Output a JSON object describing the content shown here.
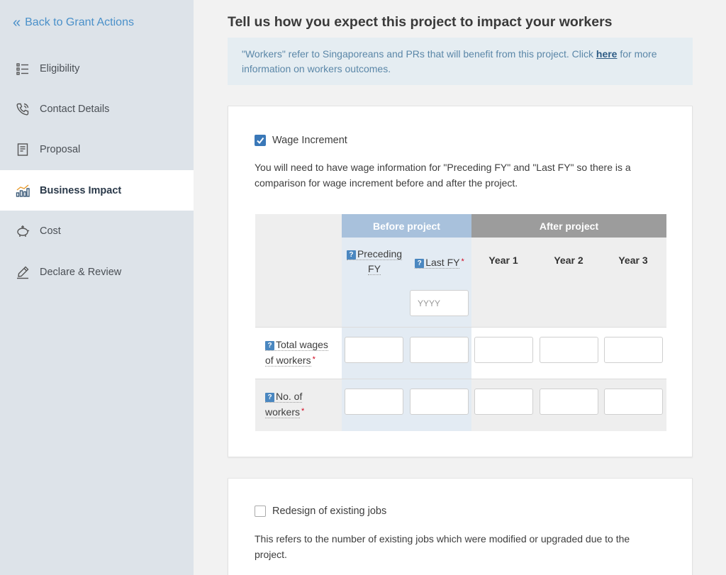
{
  "sidebar": {
    "back_label": "Back to Grant Actions",
    "items": [
      {
        "label": "Eligibility",
        "icon": "list-icon"
      },
      {
        "label": "Contact Details",
        "icon": "phone-icon"
      },
      {
        "label": "Proposal",
        "icon": "document-icon"
      },
      {
        "label": "Business Impact",
        "icon": "bar-chart-icon",
        "active": true
      },
      {
        "label": "Cost",
        "icon": "piggy-bank-icon"
      },
      {
        "label": "Declare & Review",
        "icon": "pen-icon"
      }
    ]
  },
  "main": {
    "title": "Tell us how you expect this project to impact your workers",
    "info": {
      "text_before": "\"Workers\" refer to Singaporeans and PRs that will benefit from this project. Click ",
      "link": "here",
      "text_after": " for more information on workers outcomes."
    },
    "wage_section": {
      "checkbox_label": "Wage Increment",
      "checked": true,
      "description": "You will need to have wage information for \"Preceding FY\" and \"Last FY\" so there is a comparison for wage increment before and after the project.",
      "table": {
        "before_header": "Before project",
        "after_header": "After project",
        "preceding_fy_line1": "Preceding",
        "preceding_fy_line2": "FY",
        "last_fy": "Last FY",
        "year_placeholder": "YYYY",
        "years": [
          "Year 1",
          "Year 2",
          "Year 3"
        ],
        "help_icon": "?",
        "required_mark": "*",
        "rows": [
          {
            "line1": "Total wages",
            "line2": "of workers"
          },
          {
            "line1": "No. of",
            "line2": "workers"
          }
        ]
      }
    },
    "redesign_section": {
      "checkbox_label": "Redesign of existing jobs",
      "checked": false,
      "description": "This refers to the number of existing jobs which were modified or upgraded due to the project."
    }
  },
  "colors": {
    "accent": "#3a78b8",
    "sidebar_bg": "#dde3e9",
    "before_header": "#a8c1dc",
    "after_header": "#9c9c9c",
    "required": "#d0021b"
  }
}
